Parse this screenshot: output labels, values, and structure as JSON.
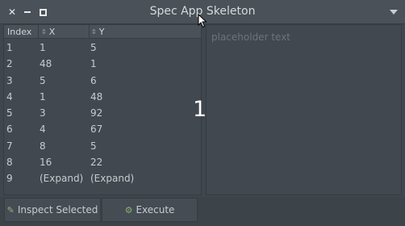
{
  "window": {
    "title": "Spec App Skeleton",
    "controls": [
      "close-icon",
      "minimize-icon",
      "maximize-icon"
    ],
    "menu_icon": "chevron-down-icon"
  },
  "table": {
    "columns": [
      "Index",
      "X",
      "Y"
    ],
    "rows": [
      [
        "1",
        "1",
        "5"
      ],
      [
        "2",
        "48",
        "1"
      ],
      [
        "3",
        "5",
        "6"
      ],
      [
        "4",
        "1",
        "48"
      ],
      [
        "5",
        "3",
        "92"
      ],
      [
        "6",
        "4",
        "67"
      ],
      [
        "7",
        "8",
        "5"
      ],
      [
        "8",
        "16",
        "22"
      ],
      [
        "9",
        "(Expand)",
        "(Expand)"
      ]
    ]
  },
  "text_area": {
    "placeholder": "placeholder text"
  },
  "overlay": {
    "number": "1"
  },
  "toolbar": {
    "inspect_label": "Inspect Selected",
    "execute_label": "Execute"
  },
  "colors": {
    "background": "#3f464d",
    "text": "#c7ccd0",
    "placeholder": "#6c737a"
  }
}
